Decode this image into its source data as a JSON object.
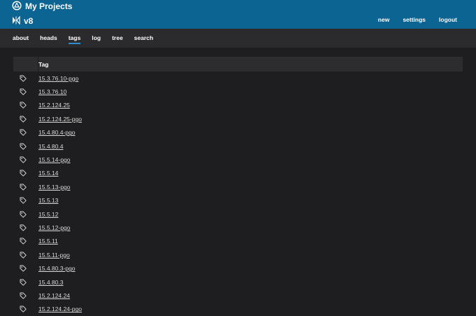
{
  "header": {
    "brand_title": "My Projects",
    "repo_name": "v8",
    "actions": [
      "new",
      "settings",
      "logout"
    ]
  },
  "nav": {
    "items": [
      "about",
      "heads",
      "tags",
      "log",
      "tree",
      "search"
    ],
    "active": "tags"
  },
  "table": {
    "column_header": "Tag",
    "rows": [
      "15.3.76.10-pgo",
      "15.3.76.10",
      "15.2.124.25",
      "15.2.124.25-pgo",
      "15.4.80.4-pgo",
      "15.4.80.4",
      "15.5.14-pgo",
      "15.5.14",
      "15.5.13-pgo",
      "15.5.13",
      "15.5.12",
      "15.5.12-pgo",
      "15.5.11",
      "15.5.11-pgo",
      "15.4.80.3-pgo",
      "15.4.80.3",
      "15.2.124.24",
      "15.2.124.24-pgo"
    ]
  },
  "colors": {
    "header_bg": "#0b6491",
    "nav_bg": "#2b2b2e",
    "page_bg": "#1e1e20",
    "table_head_bg": "#2d2d30",
    "active_underline": "#2f8ccf"
  },
  "icons": {
    "brand": "logo-icon",
    "repo": "repo-icon",
    "row": "tag-icon"
  }
}
